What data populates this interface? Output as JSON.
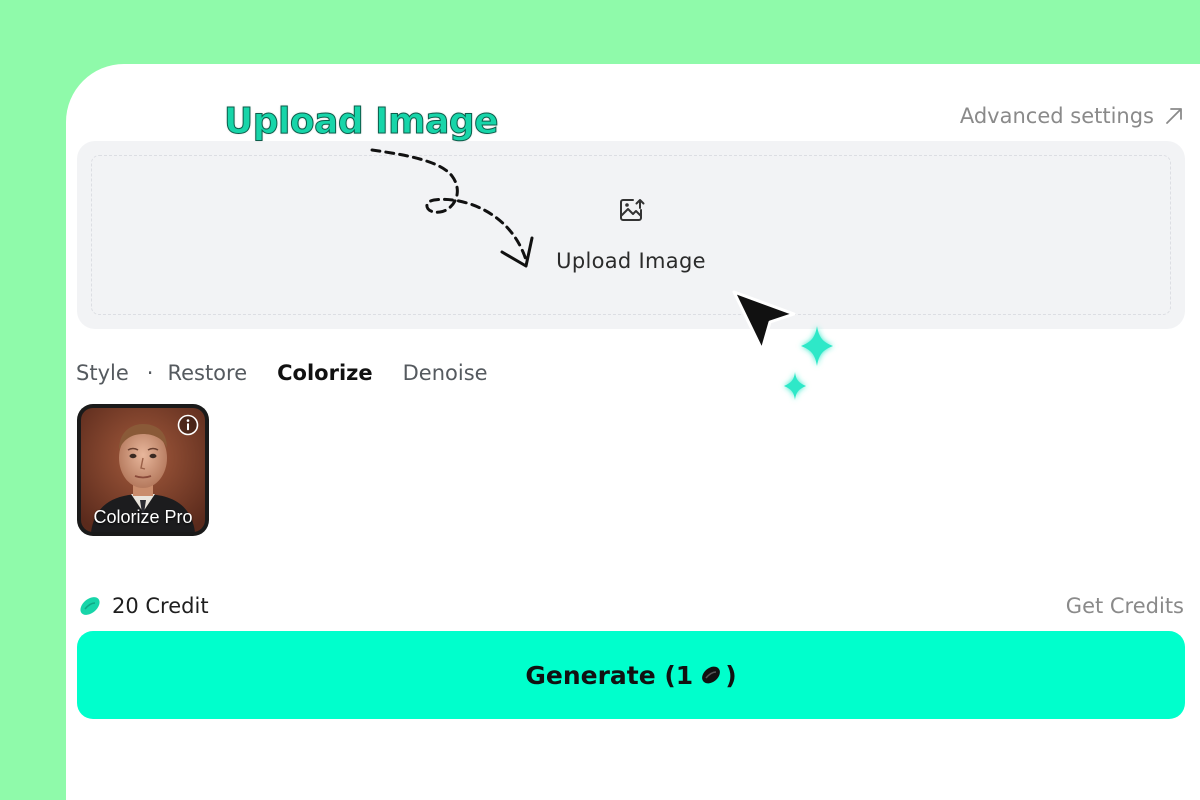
{
  "overlay": {
    "title": "Upload Image"
  },
  "header": {
    "advanced_settings": "Advanced settings"
  },
  "upload": {
    "label": "Upload Image"
  },
  "tabs": {
    "style_label": "Style",
    "separator": "·",
    "items": [
      {
        "label": "Restore",
        "active": false
      },
      {
        "label": "Colorize",
        "active": true
      },
      {
        "label": "Denoise",
        "active": false
      }
    ]
  },
  "style_cards": [
    {
      "label": "Colorize Pro",
      "selected": true
    }
  ],
  "credits": {
    "balance": "20 Credit",
    "get_credits": "Get Credits"
  },
  "generate": {
    "label_prefix": "Generate (1",
    "label_suffix": ")"
  },
  "colors": {
    "background": "#8ffaaa",
    "accent": "#00ffcc",
    "panel": "#ffffff",
    "upload_zone": "#f2f3f5"
  },
  "icons": {
    "advanced": "arrow-up-right-icon",
    "upload": "image-upload-icon",
    "credit": "bean-icon",
    "info": "info-icon",
    "cursor": "cursor-icon",
    "sparkle": "sparkle-icon"
  }
}
